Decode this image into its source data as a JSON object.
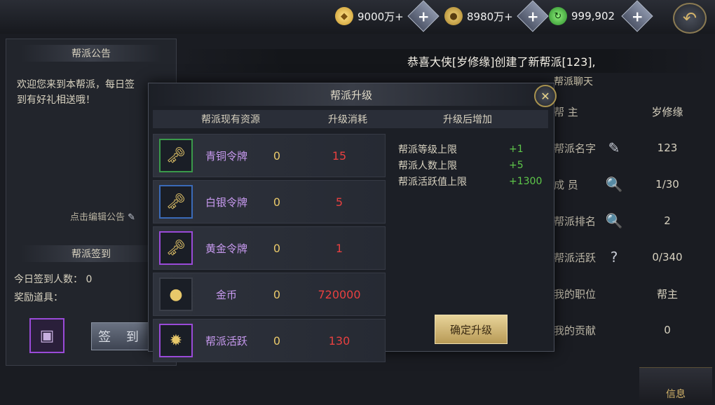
{
  "topbar": {
    "resources": [
      {
        "icon": "gold-ingot-icon",
        "value": "9000万+"
      },
      {
        "icon": "coin-icon",
        "value": "8980万+"
      },
      {
        "icon": "green-gem-icon",
        "value": "999,902"
      }
    ]
  },
  "left": {
    "notice_title": "帮派公告",
    "notice_text": "欢迎您来到本帮派，每日签到有好礼相送哦！",
    "edit_notice": "点击编辑公告",
    "checkin_title": "帮派签到",
    "checkin_count": "今日签到人数： 0",
    "reward_label": "奖励道具：",
    "checkin_button": "签 到"
  },
  "ticker": "恭喜大侠[岁修缘]创建了新帮派[123],",
  "chat_tab": "帮派聊天",
  "info": [
    {
      "label": "帮  主",
      "icon": "",
      "value": "岁修缘"
    },
    {
      "label": "帮派名字",
      "icon": "brush-icon",
      "value": "123"
    },
    {
      "label": "成  员",
      "icon": "magnifier-icon",
      "value": "1/30"
    },
    {
      "label": "帮派排名",
      "icon": "magnifier-icon",
      "value": "2"
    },
    {
      "label": "帮派活跃",
      "icon": "question-icon",
      "value": "0/340"
    },
    {
      "label": "我的职位",
      "icon": "",
      "value": "帮主"
    },
    {
      "label": "我的贡献",
      "icon": "",
      "value": "0"
    }
  ],
  "info_button": "信息",
  "dialog": {
    "title": "帮派升级",
    "columns": [
      "帮派现有资源",
      "升级消耗",
      "升级后增加"
    ],
    "resources": [
      {
        "name": "青铜令牌",
        "have": "0",
        "cost": "15",
        "name_color": "#c89af0",
        "frame": "#3a9a4a"
      },
      {
        "name": "白银令牌",
        "have": "0",
        "cost": "5",
        "name_color": "#c89af0",
        "frame": "#3a6ab8"
      },
      {
        "name": "黄金令牌",
        "have": "0",
        "cost": "1",
        "name_color": "#c89af0",
        "frame": "#9a4ad8"
      },
      {
        "name": "金币",
        "have": "0",
        "cost": "720000",
        "name_color": "#c89af0",
        "frame": "#3a3e48"
      },
      {
        "name": "帮派活跃",
        "have": "0",
        "cost": "130",
        "name_color": "#c89af0",
        "frame": "#9a4ad8"
      }
    ],
    "bonuses": [
      {
        "label": "帮派等级上限",
        "value": "+1"
      },
      {
        "label": "帮派人数上限",
        "value": "+5"
      },
      {
        "label": "帮派活跃值上限",
        "value": "+1300"
      }
    ],
    "confirm": "确定升级"
  }
}
